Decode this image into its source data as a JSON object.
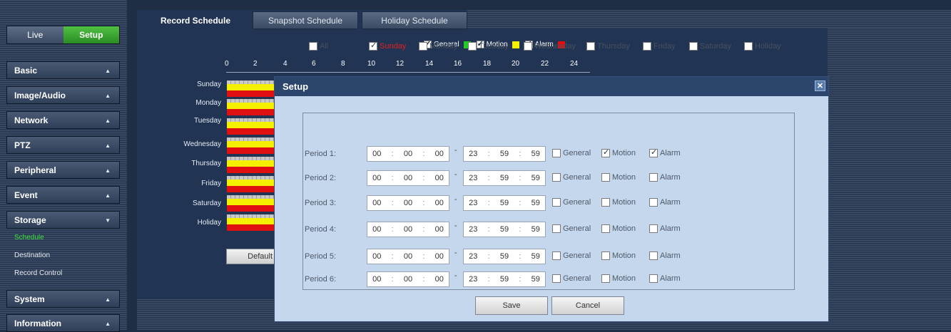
{
  "sidebar": {
    "live_label": "Live",
    "setup_label": "Setup",
    "menus": [
      {
        "label": "Basic",
        "chev": "▲"
      },
      {
        "label": "Image/Audio",
        "chev": "▲"
      },
      {
        "label": "Network",
        "chev": "▲"
      },
      {
        "label": "PTZ",
        "chev": "▲"
      },
      {
        "label": "Peripheral",
        "chev": "▲"
      },
      {
        "label": "Event",
        "chev": "▲"
      },
      {
        "label": "Storage",
        "chev": "▼"
      },
      {
        "label": "System",
        "chev": "▲"
      },
      {
        "label": "Information",
        "chev": "▲"
      }
    ],
    "storage_subitems": [
      "Schedule",
      "Destination",
      "Record Control"
    ]
  },
  "tabs": [
    "Record Schedule",
    "Snapshot Schedule",
    "Holiday Schedule"
  ],
  "legend": [
    {
      "label": "General",
      "color": "#22cc22"
    },
    {
      "label": "Motion",
      "color": "#f5f000"
    },
    {
      "label": "Alarm",
      "color": "#e01010"
    }
  ],
  "axis_ticks": [
    "0",
    "2",
    "4",
    "6",
    "8",
    "10",
    "12",
    "14",
    "16",
    "18",
    "20",
    "22",
    "24"
  ],
  "days": [
    "Sunday",
    "Monday",
    "Tuesday",
    "Wednesday",
    "Thursday",
    "Friday",
    "Saturday",
    "Holiday"
  ],
  "default_label": "Default",
  "dialog": {
    "title": "Setup",
    "close_glyph": "✕",
    "day_options": [
      {
        "label": "All",
        "checked": false
      },
      {
        "label": "Sunday",
        "checked": true
      },
      {
        "label": "Monday",
        "checked": false
      },
      {
        "label": "Tuesday",
        "checked": false
      },
      {
        "label": "Wednesday",
        "checked": false
      },
      {
        "label": "Thursday",
        "checked": false
      },
      {
        "label": "Friday",
        "checked": false
      },
      {
        "label": "Saturday",
        "checked": false
      },
      {
        "label": "Holiday",
        "checked": false
      }
    ],
    "period_labels": [
      "Period 1:",
      "Period 2:",
      "Period 3:",
      "Period 4:",
      "Period 5:",
      "Period 6:"
    ],
    "start_h": "00",
    "start_m": "00",
    "start_s": "00",
    "end_h": "23",
    "end_m": "59",
    "end_s": "59",
    "time_sep": ":",
    "range_sep": "-",
    "type_labels": [
      "General",
      "Motion",
      "Alarm"
    ],
    "period1_checked": [
      false,
      true,
      true
    ],
    "save_label": "Save",
    "cancel_label": "Cancel"
  }
}
